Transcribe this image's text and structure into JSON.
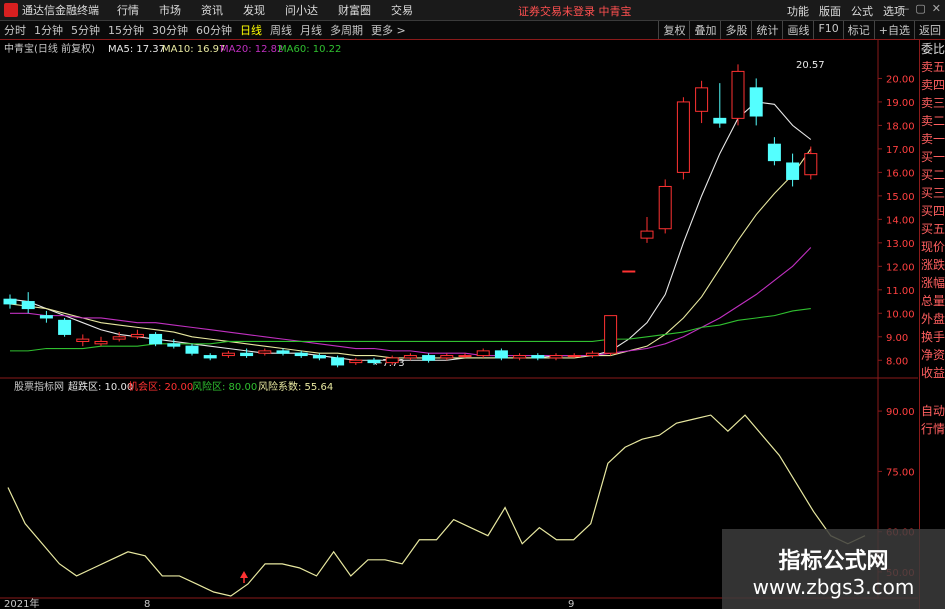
{
  "app": {
    "title": "通达信金融终端",
    "menu": [
      "行情",
      "市场",
      "资讯",
      "发现",
      "问小达",
      "财富圈",
      "交易"
    ],
    "alert": "证券交易未登录  中青宝",
    "right_menu": [
      "功能",
      "版面",
      "公式",
      "选项"
    ],
    "window_buttons": [
      "—",
      "▢",
      "✕"
    ]
  },
  "periods": [
    "分时",
    "1分钟",
    "5分钟",
    "15分钟",
    "30分钟",
    "60分钟",
    "日线",
    "周线",
    "月线",
    "多周期",
    "更多 >"
  ],
  "active_period": "日线",
  "right_tools": [
    "复权",
    "叠加",
    "多股",
    "统计",
    "画线",
    "F10",
    "标记",
    "+自选",
    "返回"
  ],
  "side_panel": [
    "委比",
    "卖五",
    "卖四",
    "卖三",
    "卖二",
    "卖一",
    "买一",
    "买二",
    "买三",
    "买四",
    "买五",
    "现价",
    "涨跌",
    "涨幅",
    "总量",
    "外盘",
    "换手",
    "净资",
    "收益"
  ],
  "side_panel_lower": [
    "自动",
    "行情"
  ],
  "price_header": {
    "name": "中青宝(日线 前复权)",
    "ma5": "MA5: 17.37",
    "ma10": "MA10: 16.97",
    "ma20": "MA20: 12.82",
    "ma60": "MA60: 10.22"
  },
  "indicator_header": {
    "name": "股票指标网",
    "a": "超跌区: 10.00",
    "b": "机会区: 20.00",
    "c": "风险区: 80.00",
    "d": "风险系数: 55.64"
  },
  "x_labels": [
    "2021年",
    "8",
    "9"
  ],
  "watermark": {
    "line1": "指标公式网",
    "line2": "www.zbgs3.com"
  },
  "colors": {
    "up": "#ff3232",
    "down": "#54ffff",
    "ma5": "#e8e8e8",
    "ma10": "#e8e8a0",
    "ma20": "#c030c0",
    "ma60": "#30c030",
    "indicator": "#e8e8a0"
  },
  "chart_data": [
    {
      "type": "candlestick",
      "title": "中青宝(日线 前复权)",
      "ylim": [
        7.5,
        20.7
      ],
      "y_ticks": [
        8.0,
        9.0,
        10.0,
        11.0,
        12.0,
        13.0,
        14.0,
        15.0,
        16.0,
        17.0,
        18.0,
        19.0,
        20.0
      ],
      "annotations": [
        {
          "label": "20.57",
          "value": 20.57
        },
        {
          "label": "←7.73",
          "value": 7.73
        }
      ],
      "candles": [
        [
          10.6,
          10.4,
          10.8,
          10.2
        ],
        [
          10.5,
          10.2,
          10.9,
          10.0
        ],
        [
          9.9,
          9.8,
          10.1,
          9.6
        ],
        [
          9.7,
          9.1,
          9.8,
          9.0
        ],
        [
          8.8,
          8.9,
          9.1,
          8.6
        ],
        [
          8.7,
          8.8,
          9.0,
          8.6
        ],
        [
          8.9,
          9.0,
          9.2,
          8.8
        ],
        [
          9.0,
          9.1,
          9.3,
          8.9
        ],
        [
          9.1,
          8.7,
          9.2,
          8.6
        ],
        [
          8.7,
          8.6,
          8.9,
          8.5
        ],
        [
          8.6,
          8.3,
          8.7,
          8.2
        ],
        [
          8.2,
          8.1,
          8.3,
          8.0
        ],
        [
          8.2,
          8.3,
          8.4,
          8.1
        ],
        [
          8.3,
          8.2,
          8.5,
          8.1
        ],
        [
          8.3,
          8.4,
          8.5,
          8.2
        ],
        [
          8.4,
          8.3,
          8.5,
          8.2
        ],
        [
          8.3,
          8.2,
          8.4,
          8.1
        ],
        [
          8.2,
          8.1,
          8.3,
          8.0
        ],
        [
          8.1,
          7.8,
          8.2,
          7.7
        ],
        [
          7.9,
          8.0,
          8.1,
          7.8
        ],
        [
          8.0,
          7.9,
          8.1,
          7.8
        ],
        [
          7.9,
          8.1,
          8.2,
          7.8
        ],
        [
          8.1,
          8.2,
          8.3,
          8.0
        ],
        [
          8.2,
          8.0,
          8.3,
          7.9
        ],
        [
          8.1,
          8.2,
          8.3,
          8.0
        ],
        [
          8.2,
          8.2,
          8.3,
          8.1
        ],
        [
          8.2,
          8.4,
          8.5,
          8.1
        ],
        [
          8.4,
          8.1,
          8.5,
          8.0
        ],
        [
          8.1,
          8.2,
          8.3,
          8.0
        ],
        [
          8.2,
          8.1,
          8.3,
          8.0
        ],
        [
          8.1,
          8.2,
          8.3,
          8.0
        ],
        [
          8.2,
          8.2,
          8.3,
          8.1
        ],
        [
          8.2,
          8.3,
          8.4,
          8.1
        ],
        [
          8.3,
          9.9,
          9.9,
          8.2
        ],
        [
          11.8,
          11.8,
          11.8,
          11.8
        ],
        [
          13.2,
          13.5,
          14.1,
          13.0
        ],
        [
          13.6,
          15.4,
          15.7,
          13.4
        ],
        [
          16.0,
          19.0,
          19.2,
          15.7
        ],
        [
          18.6,
          19.6,
          19.9,
          18.1
        ],
        [
          18.3,
          18.1,
          19.8,
          17.9
        ],
        [
          18.3,
          20.3,
          20.6,
          18.0
        ],
        [
          19.6,
          18.4,
          20.0,
          18.0
        ],
        [
          17.2,
          16.5,
          17.5,
          16.3
        ],
        [
          16.4,
          15.7,
          16.8,
          15.4
        ],
        [
          15.9,
          16.8,
          17.1,
          15.7
        ]
      ],
      "series": [
        {
          "name": "MA5",
          "values": [
            10.6,
            10.5,
            10.2,
            9.9,
            9.6,
            9.3,
            9.1,
            9.0,
            8.9,
            8.8,
            8.7,
            8.6,
            8.5,
            8.4,
            8.3,
            8.3,
            8.3,
            8.2,
            8.1,
            8.0,
            8.0,
            8.0,
            8.0,
            8.0,
            8.0,
            8.1,
            8.1,
            8.1,
            8.1,
            8.1,
            8.2,
            8.2,
            8.2,
            8.4,
            8.9,
            9.6,
            10.8,
            13.0,
            15.0,
            16.8,
            18.3,
            19.0,
            18.9,
            18.0,
            17.4
          ]
        },
        {
          "name": "MA10",
          "values": [
            10.4,
            10.3,
            10.2,
            10.0,
            9.8,
            9.6,
            9.5,
            9.4,
            9.3,
            9.2,
            9.0,
            8.9,
            8.8,
            8.7,
            8.6,
            8.5,
            8.4,
            8.3,
            8.3,
            8.2,
            8.2,
            8.1,
            8.1,
            8.1,
            8.1,
            8.1,
            8.1,
            8.1,
            8.1,
            8.1,
            8.1,
            8.1,
            8.2,
            8.2,
            8.4,
            8.6,
            9.1,
            9.8,
            10.7,
            11.9,
            13.1,
            14.2,
            15.1,
            15.9,
            17.0
          ]
        },
        {
          "name": "MA20",
          "values": [
            10.0,
            10.0,
            9.9,
            9.9,
            9.8,
            9.8,
            9.7,
            9.6,
            9.6,
            9.5,
            9.4,
            9.3,
            9.2,
            9.1,
            9.0,
            8.9,
            8.8,
            8.7,
            8.6,
            8.5,
            8.5,
            8.4,
            8.4,
            8.3,
            8.3,
            8.3,
            8.2,
            8.2,
            8.2,
            8.2,
            8.2,
            8.2,
            8.2,
            8.3,
            8.4,
            8.5,
            8.7,
            9.0,
            9.4,
            9.8,
            10.3,
            10.8,
            11.4,
            12.0,
            12.8
          ]
        },
        {
          "name": "MA60",
          "values": [
            8.4,
            8.4,
            8.5,
            8.5,
            8.5,
            8.6,
            8.6,
            8.6,
            8.7,
            8.7,
            8.7,
            8.7,
            8.8,
            8.8,
            8.8,
            8.8,
            8.8,
            8.8,
            8.8,
            8.8,
            8.8,
            8.8,
            8.8,
            8.8,
            8.8,
            8.8,
            8.8,
            8.8,
            8.8,
            8.8,
            8.8,
            8.8,
            8.8,
            8.9,
            8.9,
            9.0,
            9.1,
            9.2,
            9.4,
            9.5,
            9.7,
            9.8,
            9.9,
            10.1,
            10.2
          ]
        }
      ]
    },
    {
      "type": "line",
      "title": "股票指标网",
      "ylim": [
        45,
        94
      ],
      "y_ticks": [
        50.0,
        60.0,
        75.0,
        90.0
      ],
      "series": [
        {
          "name": "风险系数",
          "values": [
            71,
            62,
            57,
            52,
            49,
            51,
            53,
            55,
            54,
            49,
            49,
            47,
            45,
            44,
            47,
            52,
            52,
            51,
            49,
            55,
            49,
            53,
            53,
            52,
            58,
            58,
            63,
            61,
            59,
            66,
            57,
            61,
            58,
            58,
            62,
            77,
            81,
            83,
            84,
            87,
            88,
            89,
            85,
            89,
            84,
            79,
            72,
            65,
            59,
            57,
            59
          ]
        }
      ]
    }
  ]
}
